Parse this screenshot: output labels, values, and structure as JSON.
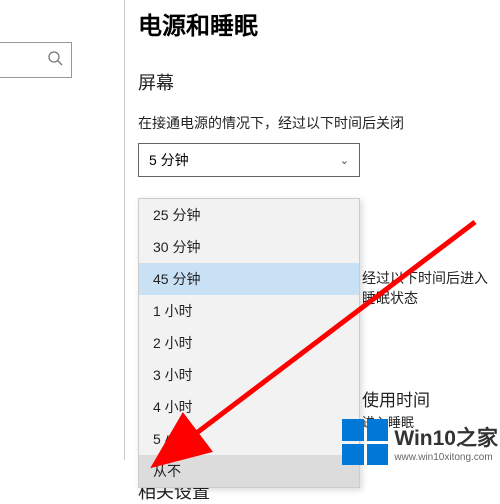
{
  "page_title": "电源和睡眠",
  "section_screen": "屏幕",
  "screen_label": "在接通电源的情况下，经过以下时间后关闭",
  "screen_select_value": "5 分钟",
  "dropdown": {
    "items": [
      {
        "label": "25 分钟"
      },
      {
        "label": "30 分钟"
      },
      {
        "label": "45 分钟"
      },
      {
        "label": "1 小时"
      },
      {
        "label": "2 小时"
      },
      {
        "label": "3 小时"
      },
      {
        "label": "4 小时"
      },
      {
        "label": "5 小时"
      },
      {
        "label": "从不"
      }
    ],
    "highlight_index": 2,
    "hover_index": 8
  },
  "bg_text_sleep_label": "经过以下时间后进入睡眠状态",
  "bg_heading_usage": "使用时间",
  "bg_text_sleep": "进入睡眠",
  "section_related": "相关设置",
  "watermark": "Win10之家",
  "watermark_url": "www.win10xitong.com",
  "colors": {
    "accent": "#0078d7",
    "highlight": "#c9e1f5",
    "arrow": "#ff0000"
  }
}
